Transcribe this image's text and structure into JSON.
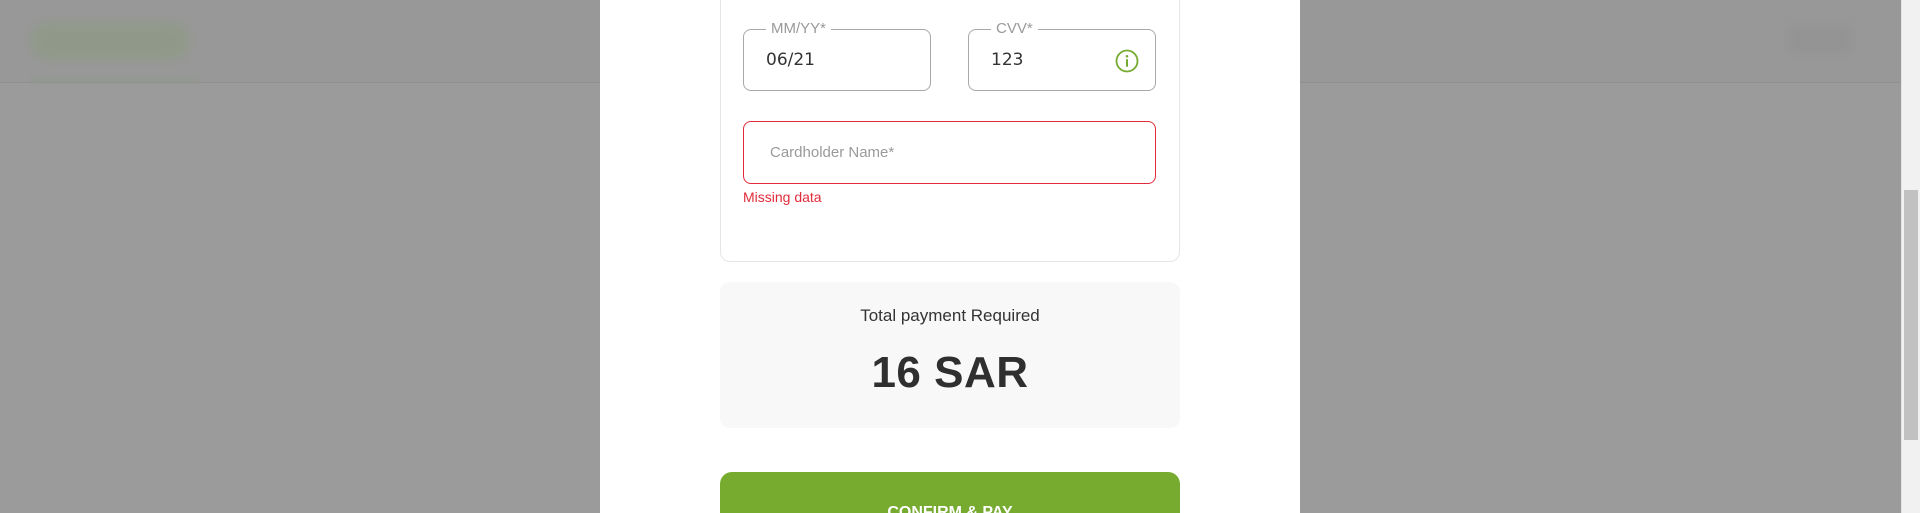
{
  "payment_form": {
    "expiry": {
      "label": "MM/YY*",
      "value": "06/21"
    },
    "cvv": {
      "label": "CVV*",
      "value": "123",
      "icon": "info-icon"
    },
    "cardholder_name": {
      "placeholder": "Cardholder Name*",
      "value": "",
      "error": "Missing data"
    }
  },
  "total": {
    "label": "Total payment Required",
    "amount": "16 SAR"
  },
  "confirm_button": {
    "label": "CONFIRM & PAY"
  },
  "colors": {
    "accent": "#76ab30",
    "error": "#e02b3a",
    "overlay": "#9b9b9b"
  }
}
